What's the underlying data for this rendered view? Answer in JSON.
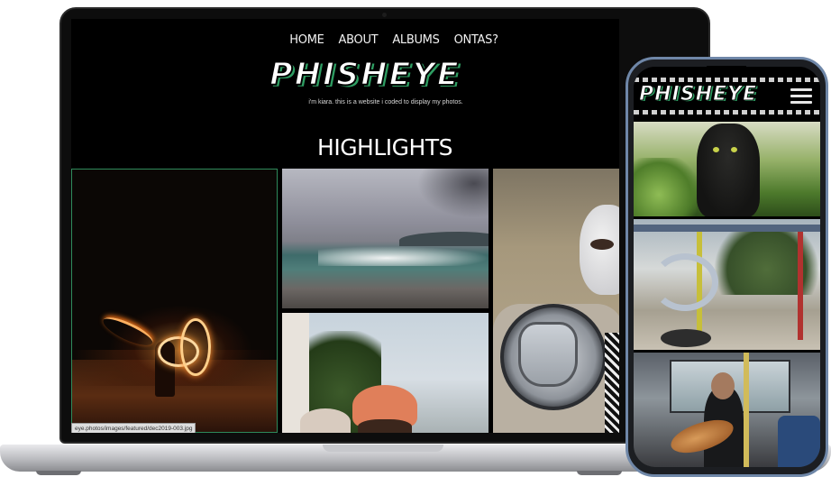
{
  "desktop": {
    "nav": [
      "HOME",
      "ABOUT",
      "ALBUMS",
      "ONTAS?"
    ],
    "logo": "PHISHEYE",
    "tagline": "i'm kiara. this is a website i coded to display my photos.",
    "section_title": "HIGHLIGHTS",
    "status_url": "eye.photos/images/featured/dec2019-003.jpg"
  },
  "mobile": {
    "logo": "PHISHEYE",
    "menu_icon": "hamburger-menu-icon"
  },
  "colors": {
    "accent": "#2e9d62",
    "background": "#000000",
    "phone_frame": "#6f87a8"
  }
}
